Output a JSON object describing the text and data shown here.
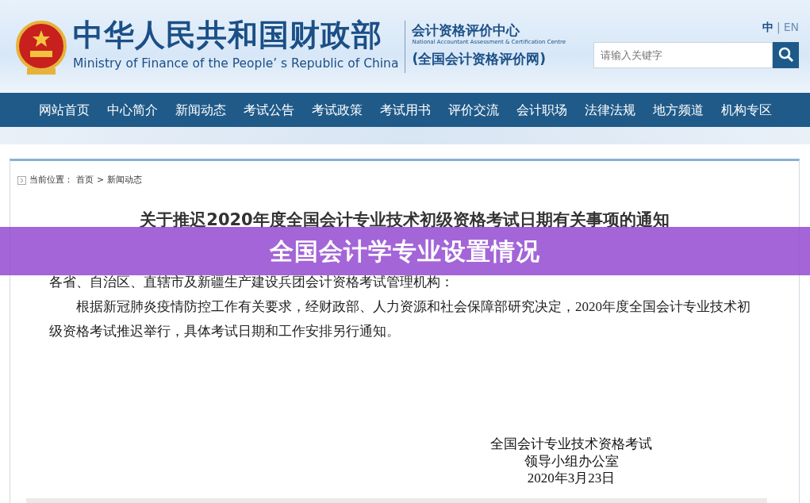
{
  "header": {
    "title_cn": "中华人民共和国财政部",
    "title_en": "Ministry of Finance of the People’ s Republic of China",
    "center_cn": "会计资格评价中心",
    "center_en": "National Accountant Assessment & Certification Centre",
    "site_name": "(全国会计资格评价网)",
    "languages": [
      {
        "label": "中",
        "selected": true
      },
      {
        "label": "EN",
        "selected": false
      }
    ],
    "separator": "|",
    "search": {
      "placeholder": "请输入关键字"
    }
  },
  "nav": [
    {
      "label": "网站首页"
    },
    {
      "label": "中心简介"
    },
    {
      "label": "新闻动态"
    },
    {
      "label": "考试公告"
    },
    {
      "label": "考试政策"
    },
    {
      "label": "考试用书"
    },
    {
      "label": "评价交流"
    },
    {
      "label": "会计职场"
    },
    {
      "label": "法律法规"
    },
    {
      "label": "地方频道"
    },
    {
      "label": "机构专区"
    }
  ],
  "breadcrumb": {
    "prefix": "当前位置：",
    "items": [
      "首页",
      "新闻动态"
    ],
    "separator": ">"
  },
  "article": {
    "title": "关于推迟2020年度全国会计专业技术初级资格考试日期有关事项的通知",
    "salutation": "各省、自治区、直辖市及新疆生产建设兵团会计资格考试管理机构：",
    "body": "根据新冠肺炎疫情防控工作有关要求，经财政部、人力资源和社会保障部研究决定，2020年度全国会计专业技术初级资格考试推迟举行，具体考试日期和工作安排另行通知。",
    "signature": [
      "全国会计专业技术资格考试",
      "领导小组办公室",
      "2020年3月23日"
    ]
  },
  "overlay": {
    "title": "全国会计学专业设置情况"
  }
}
